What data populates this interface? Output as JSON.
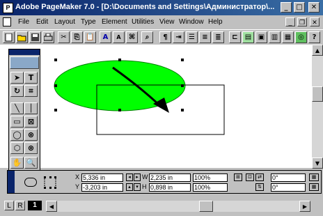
{
  "window": {
    "title": "Adobe PageMaker 7.0 - [D:\\Documents and Settings\\Администратор\\...",
    "app_icon": "P"
  },
  "window_controls": {
    "minimize": "_",
    "maximize": "□",
    "close": "✕"
  },
  "menu": {
    "items": [
      "File",
      "Edit",
      "Layout",
      "Type",
      "Element",
      "Utilities",
      "View",
      "Window",
      "Help"
    ]
  },
  "mdi_controls": {
    "minimize": "_",
    "restore": "❐",
    "close": "✕"
  },
  "toolbar": {
    "font_up": "A",
    "font_down": "A",
    "paragraph": "¶"
  },
  "toolbox": {
    "text_tool": "T"
  },
  "control_palette": {
    "x_label": "X",
    "y_label": "Y",
    "x_value": "5,336 in",
    "y_value": "-3,203 in",
    "w_label": "W",
    "h_label": "H",
    "w_value": "2,235 in",
    "h_value": "0,898 in",
    "w_scale": "100%",
    "h_scale": "100%",
    "rotation": "0°",
    "skew": "0°"
  },
  "pages": {
    "left_tab": "L",
    "right_tab": "R",
    "current_page": "1"
  },
  "colors": {
    "ellipse_fill": "#00ff00",
    "title_bar": "#0a246a"
  }
}
